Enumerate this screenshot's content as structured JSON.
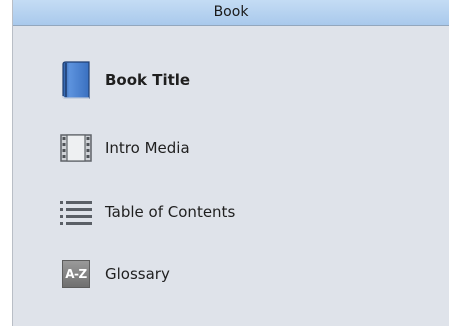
{
  "header": {
    "title": "Book"
  },
  "items": [
    {
      "label": "Book Title",
      "icon": "book-icon"
    },
    {
      "label": "Intro Media",
      "icon": "film-strip-icon"
    },
    {
      "label": "Table of Contents",
      "icon": "list-icon"
    },
    {
      "label": "Glossary",
      "icon": "glossary-az-icon",
      "icon_text": "A-Z"
    }
  ],
  "colors": {
    "panel_bg": "#dfe3ea",
    "header_bg": "#b7d2ef",
    "book_blue": "#3e76c6"
  }
}
